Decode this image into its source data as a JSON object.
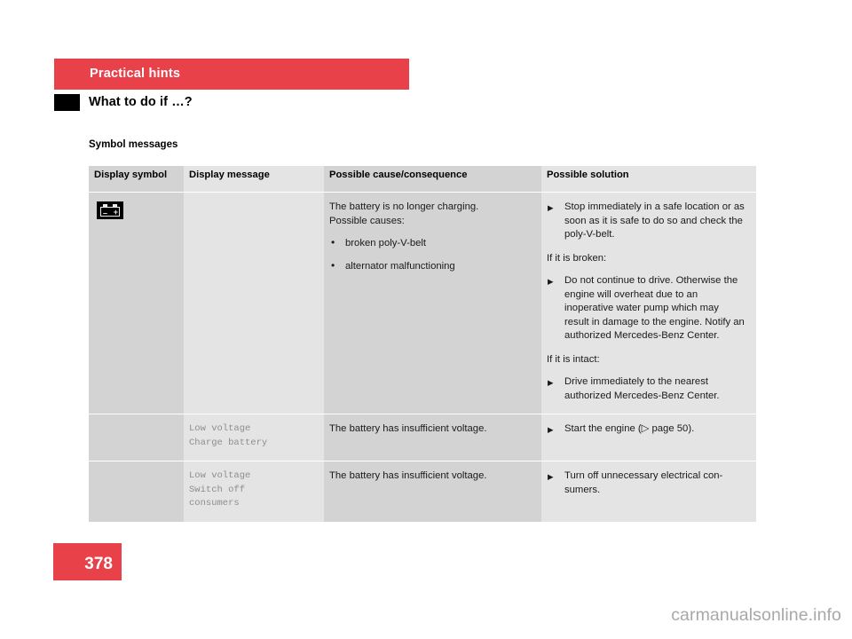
{
  "header": {
    "chapter": "Practical hints",
    "section_title": "What to do if …?",
    "subsection_title": "Symbol messages"
  },
  "table": {
    "columns": [
      "Display symbol",
      "Display message",
      "Possible cause/consequence",
      "Possible solution"
    ],
    "rows": [
      {
        "symbol_icon": "battery-icon",
        "display_message": "",
        "cause": {
          "intro_line_1": "The battery is no longer charging.",
          "intro_line_2": "Possible causes:",
          "bullets": [
            "broken poly-V-belt",
            "alternator malfunctioning"
          ]
        },
        "solution": {
          "items_1": [
            "Stop immediately in a safe location or as soon as it is safe to do so and check the poly-V-belt."
          ],
          "lead_in_1": "If it is broken:",
          "items_2": [
            "Do not continue to drive. Otherwise the engine will overheat due to an inoperative water pump which may result in damage to the engine. Notify an authorized Mercedes-Benz Center."
          ],
          "lead_in_2": "If it is intact:",
          "items_3": [
            "Drive immediately to the nearest authorized Mercedes-Benz Center."
          ]
        }
      },
      {
        "symbol_icon": "",
        "display_message": "Low voltage\nCharge battery",
        "cause_text": "The battery has insufficient voltage.",
        "solution_items": [
          "Start the engine (▷ page 50)."
        ]
      },
      {
        "symbol_icon": "",
        "display_message": "Low voltage\nSwitch off\nconsumers",
        "cause_text": "The battery has insufficient voltage.",
        "solution_items": [
          "Turn off unnecessary electrical con-sumers."
        ]
      }
    ]
  },
  "footer": {
    "page_number": "378",
    "watermark": "carmanualsonline.info"
  },
  "colors": {
    "accent_red": "#E8414A",
    "column_shade_dark": "#d3d3d3",
    "column_shade_light": "#e4e4e4",
    "display_message_text": "#8e8e8e"
  }
}
